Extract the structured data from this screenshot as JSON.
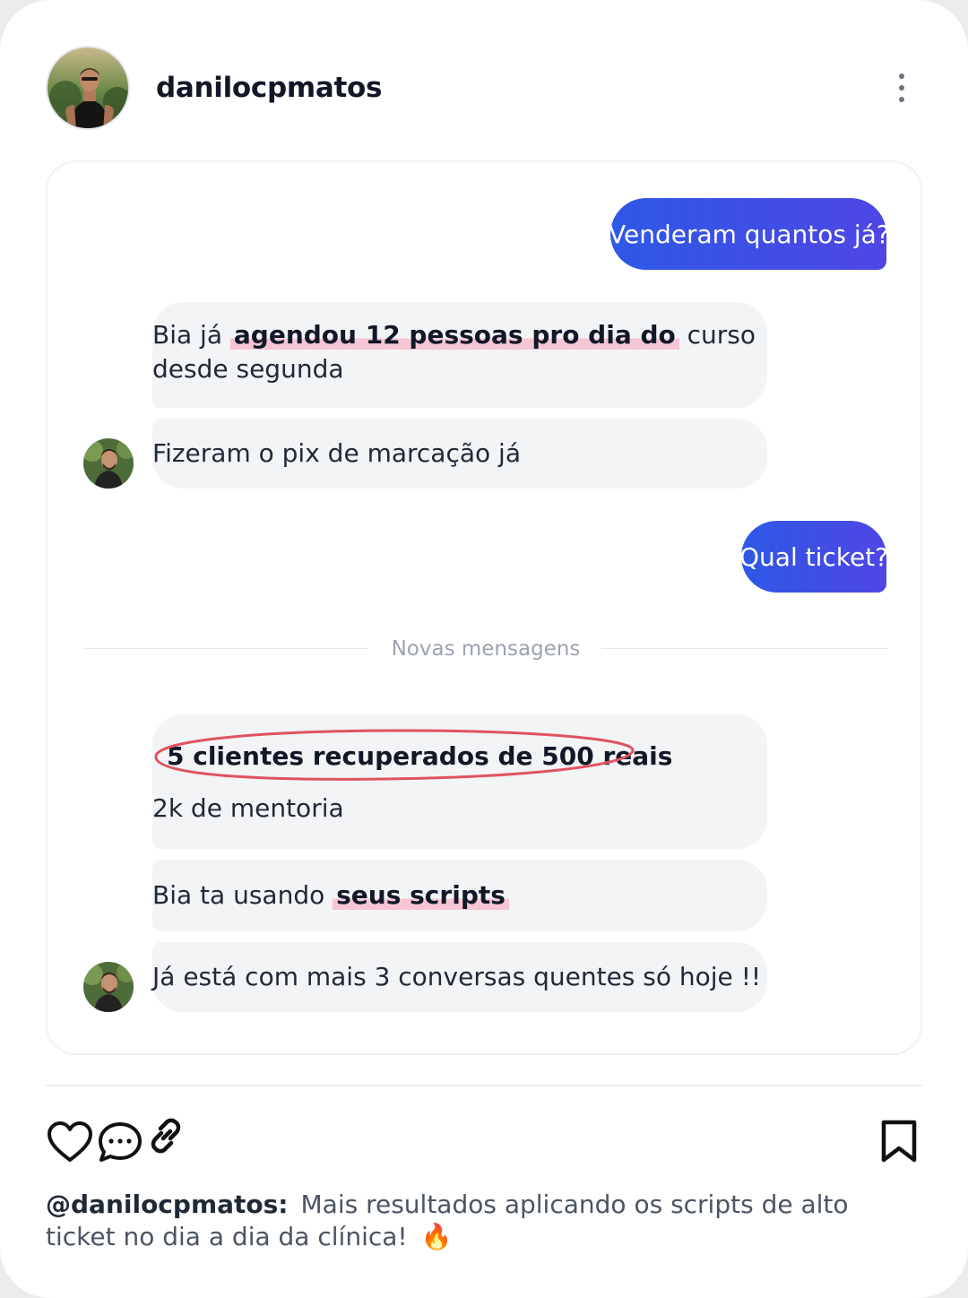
{
  "post": {
    "username": "danilocpmatos",
    "more_icon": "more-vertical-icon"
  },
  "chat": {
    "outgoing_1": "Venderam quantos já?",
    "incoming_1": {
      "before": "Bia já",
      "highlight": "agendou 12 pessoas pro dia do",
      "after_line1": "curso",
      "line2": "desde segunda"
    },
    "incoming_2": "Fizeram o pix de marcação já",
    "outgoing_2": "Qual ticket?",
    "divider_label": "Novas mensagens",
    "incoming_3": {
      "line1": "5 clientes recuperados de 500 reais",
      "line2": "2k de mentoria"
    },
    "incoming_4": {
      "before": "Bia ta usando",
      "highlight": "seus scripts"
    },
    "incoming_5": "Já está com mais 3 conversas quentes só hoje !!"
  },
  "actions": {
    "like_icon": "heart-icon",
    "comment_icon": "comment-icon",
    "share_icon": "link-icon",
    "save_icon": "bookmark-icon"
  },
  "caption": {
    "handle": "@danilocpmatos:",
    "text": "Mais resultados aplicando os scripts de alto ticket no dia a dia da clínica!",
    "emoji": "🔥"
  },
  "colors": {
    "bubble_out_start": "#2e58e6",
    "bubble_out_end": "#4f46e5",
    "bubble_in": "#f3f4f6",
    "highlight": "#f6c6d4",
    "annotation_circle": "#e0535f"
  }
}
